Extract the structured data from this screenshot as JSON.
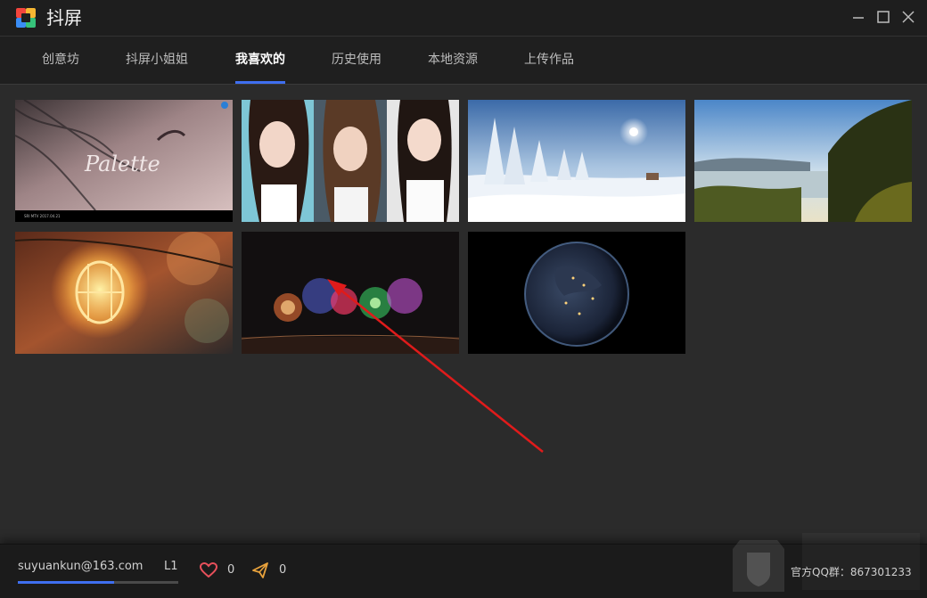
{
  "window": {
    "title": "抖屏",
    "controls": {
      "minimize_icon": "minimize-icon",
      "maximize_icon": "maximize-icon",
      "close_icon": "close-icon"
    }
  },
  "tabs": [
    {
      "label": "创意坊",
      "active": false
    },
    {
      "label": "抖屏小姐姐",
      "active": false
    },
    {
      "label": "我喜欢的",
      "active": true
    },
    {
      "label": "历史使用",
      "active": false
    },
    {
      "label": "本地资源",
      "active": false
    },
    {
      "label": "上传作品",
      "active": false
    }
  ],
  "gallery": {
    "items": [
      {
        "kind": "palette-video",
        "text": "Palette",
        "caption": "SRI MTV 2017.04.21"
      },
      {
        "kind": "three-girls"
      },
      {
        "kind": "snow-scene"
      },
      {
        "kind": "lake-sunset"
      },
      {
        "kind": "light-bulb"
      },
      {
        "kind": "fireworks"
      },
      {
        "kind": "earth-night"
      }
    ]
  },
  "footer": {
    "user_email": "suyuankun@163.com",
    "level": "L1",
    "level_progress_pct": 60,
    "likes_count": "0",
    "shares_count": "0",
    "qq_group": "官方QQ群：867301233",
    "icons": {
      "like": "heart-icon",
      "share": "paper-plane-icon"
    }
  },
  "colors": {
    "accent": "#3f6ff0",
    "background": "#2b2b2b",
    "annotation": "#e01b1b",
    "like": "#e8505b",
    "share": "#e8a23c"
  }
}
